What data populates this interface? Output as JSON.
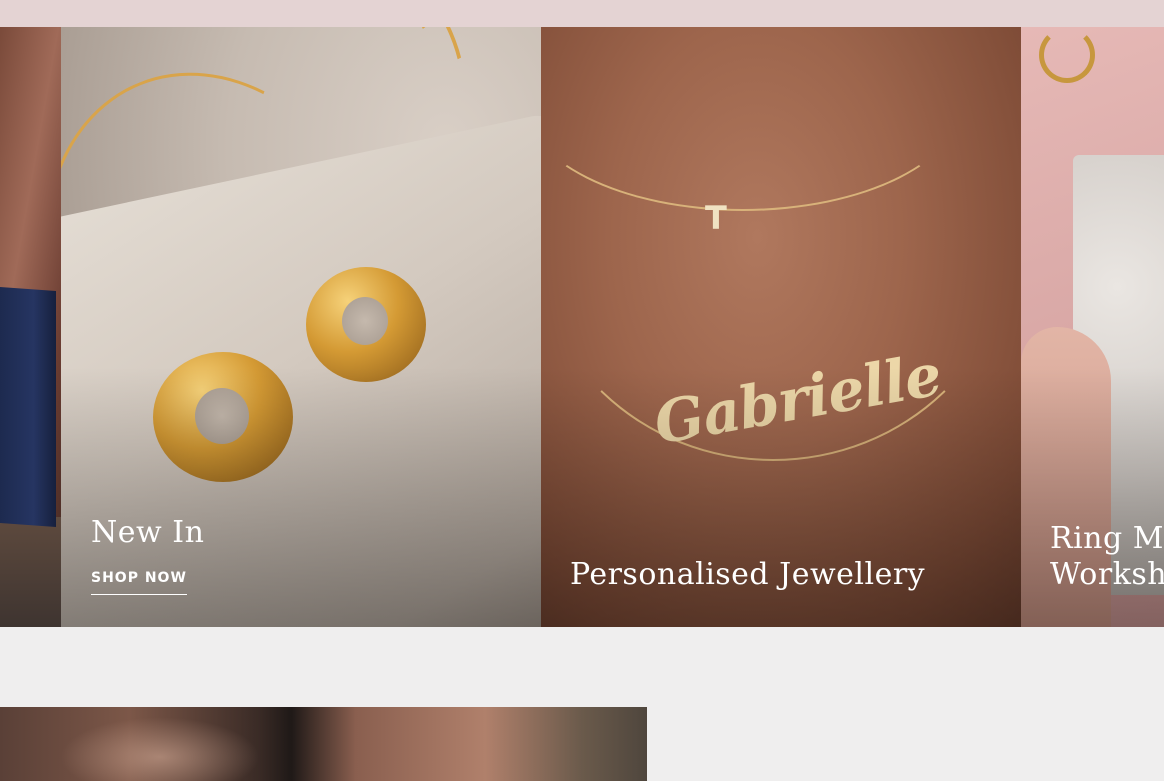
{
  "carousel": {
    "slides": [
      {
        "title": ""
      },
      {
        "title": "New In",
        "cta": "SHOP NOW"
      },
      {
        "title": "Personalised Jewellery"
      },
      {
        "title_line1": "Ring Ma",
        "title_line2": "Worksh"
      }
    ]
  },
  "slide_art": {
    "initial": "T",
    "nameplate": "Gabrielle"
  },
  "colors": {
    "topbar": "#e4d3d3",
    "page_background": "#efeeee",
    "overlay_text": "#ffffff",
    "gold": "#d49a34"
  }
}
